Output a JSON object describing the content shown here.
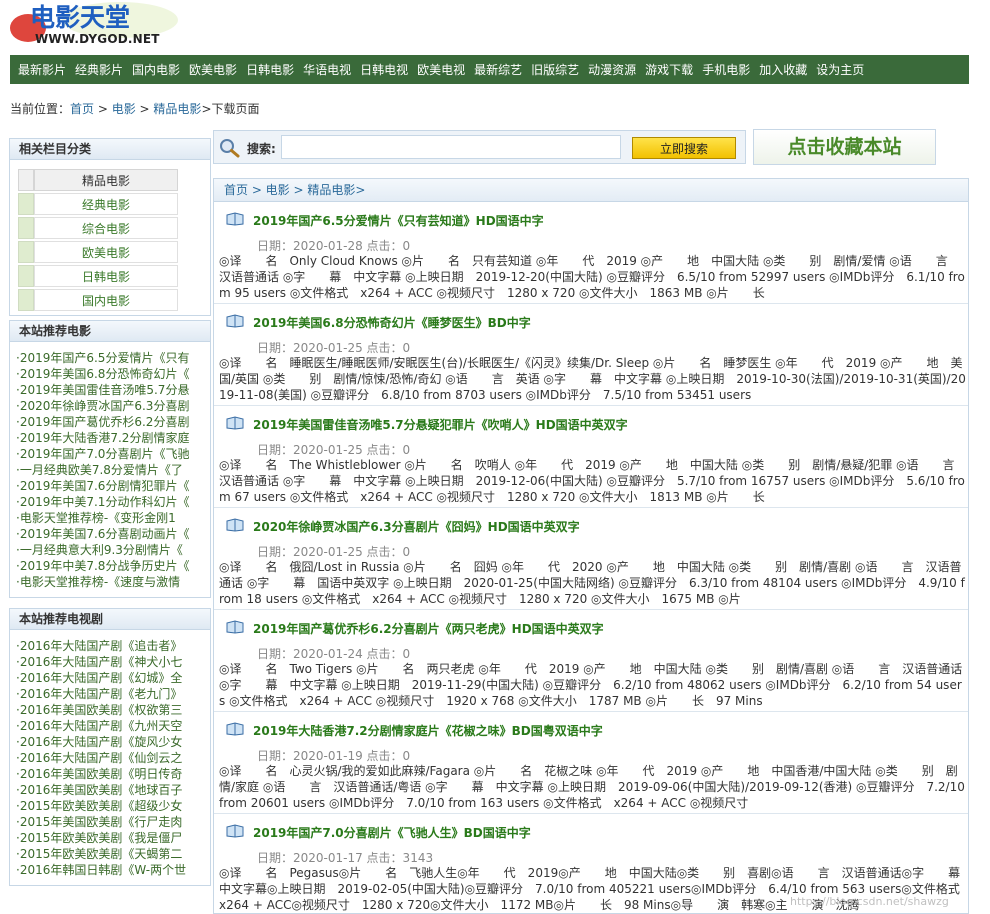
{
  "header": {
    "logo_text": "电影天堂",
    "logo_url": "WWW.DYGOD.NET",
    "nav": [
      "最新影片",
      "经典影片",
      "国内电影",
      "欧美电影",
      "日韩电影",
      "华语电视",
      "日韩电视",
      "欧美电视",
      "最新综艺",
      "旧版综艺",
      "动漫资源",
      "游戏下载",
      "手机电影",
      "加入收藏",
      "设为主页"
    ]
  },
  "breadcrumb": {
    "prefix": "当前位置：",
    "items": [
      "首页",
      "电影",
      "精品电影"
    ],
    "sep": " > ",
    "current": "下载页面"
  },
  "sidebar": {
    "category_title": "相关栏目分类",
    "categories": [
      "精品电影",
      "经典电影",
      "综合电影",
      "欧美电影",
      "日韩电影",
      "国内电影"
    ],
    "rec_movie_title": "本站推荐电影",
    "rec_movies": [
      "·2019年国产6.5分爱情片《只有",
      "·2019年美国6.8分恐怖奇幻片《",
      "·2019年美国雷佳音汤唯5.7分悬",
      "·2020年徐峥贾冰国产6.3分喜剧",
      "·2019年国产葛优乔杉6.2分喜剧",
      "·2019年大陆香港7.2分剧情家庭",
      "·2019年国产7.0分喜剧片《飞驰",
      "·一月经典欧美7.8分爱情片《了",
      "·2019年美国7.6分剧情犯罪片《",
      "·2019年中美7.1分动作科幻片《",
      "·电影天堂推荐榜-《变形金刚1",
      "·2019年美国7.6分喜剧动画片《",
      "·一月经典意大利9.3分剧情片《",
      "·2019年中美7.8分战争历史片《",
      "·电影天堂推荐榜-《速度与激情"
    ],
    "rec_tv_title": "本站推荐电视剧",
    "rec_tv": [
      "·2016年大陆国产剧《追击者》",
      "·2016年大陆国产剧《神犬小七",
      "·2016年大陆国产剧《幻城》全",
      "·2016年大陆国产剧《老九门》",
      "·2016年美国欧美剧《权欲第三",
      "·2016年大陆国产剧《九州天空",
      "·2016年大陆国产剧《旋风少女",
      "·2016年大陆国产剧《仙剑云之",
      "·2016年美国欧美剧《明日传奇",
      "·2016年美国欧美剧《地球百子",
      "·2015年欧美欧美剧《超级少女",
      "·2015年美国欧美剧《行尸走肉",
      "·2015年欧美欧美剧《我是僵尸",
      "·2015年欧美欧美剧《天蝎第二",
      "·2016年韩国日韩剧《W-两个世"
    ]
  },
  "search": {
    "label": "搜索:",
    "placeholder": "",
    "button": "立即搜索",
    "favorite": "点击收藏本站"
  },
  "main": {
    "crumb": "首页 > 电影 > 精品电影>",
    "entries": [
      {
        "title": "2019年国产6.5分爱情片《只有芸知道》HD国语中字",
        "date": "日期：2020-01-28 点击：0",
        "desc": "◎译　　名　Only Cloud Knows ◎片　　名　只有芸知道 ◎年　　代　2019 ◎产　　地　中国大陆 ◎类　　别　剧情/爱情 ◎语　　言　汉语普通话 ◎字　　幕　中文字幕 ◎上映日期　2019-12-20(中国大陆) ◎豆瓣评分　6.5/10 from 52997 users ◎IMDb评分　6.1/10 from 95 users ◎文件格式　x264 + ACC ◎视频尺寸　1280 x 720 ◎文件大小　1863 MB ◎片　　长"
      },
      {
        "title": "2019年美国6.8分恐怖奇幻片《睡梦医生》BD中字",
        "date": "日期：2020-01-25 点击：0",
        "desc": "◎译　　名　睡眠医生/睡眠医师/安眠医生(台)/长眠医生/《闪灵》续集/Dr. Sleep ◎片　　名　睡梦医生 ◎年　　代　2019 ◎产　　地　美国/英国 ◎类　　别　剧情/惊悚/恐怖/奇幻 ◎语　　言　英语 ◎字　　幕　中文字幕 ◎上映日期　2019-10-30(法国)/2019-10-31(英国)/2019-11-08(美国) ◎豆瓣评分　6.8/10 from 8703 users ◎IMDb评分　7.5/10 from 53451 users"
      },
      {
        "title": "2019年美国雷佳音汤唯5.7分悬疑犯罪片《吹哨人》HD国语中英双字",
        "date": "日期：2020-01-25 点击：0",
        "desc": "◎译　　名　The Whistleblower ◎片　　名　吹哨人 ◎年　　代　2019 ◎产　　地　中国大陆 ◎类　　别　剧情/悬疑/犯罪 ◎语　　言　汉语普通话 ◎字　　幕　中文字幕 ◎上映日期　2019-12-06(中国大陆) ◎豆瓣评分　5.7/10 from 16757 users ◎IMDb评分　5.6/10 from 67 users ◎文件格式　x264 + ACC ◎视频尺寸　1280 x 720 ◎文件大小　1813 MB ◎片　　长"
      },
      {
        "title": "2020年徐峥贾冰国产6.3分喜剧片《囧妈》HD国语中英双字",
        "date": "日期：2020-01-25 点击：0",
        "desc": "◎译　　名　俄囧/Lost in Russia ◎片　　名　囧妈 ◎年　　代　2020 ◎产　　地　中国大陆 ◎类　　别　剧情/喜剧 ◎语　　言　汉语普通话 ◎字　　幕　国语中英双字 ◎上映日期　2020-01-25(中国大陆网络) ◎豆瓣评分　6.3/10 from 48104 users ◎IMDb评分　4.9/10 from 18 users ◎文件格式　x264 + ACC ◎视频尺寸　1280 x 720 ◎文件大小　1675 MB ◎片"
      },
      {
        "title": "2019年国产葛优乔杉6.2分喜剧片《两只老虎》HD国语中英双字",
        "date": "日期：2020-01-24 点击：0",
        "desc": "◎译　　名　Two Tigers ◎片　　名　两只老虎 ◎年　　代　2019 ◎产　　地　中国大陆 ◎类　　别　剧情/喜剧 ◎语　　言　汉语普通话 ◎字　　幕　中文字幕 ◎上映日期　2019-11-29(中国大陆) ◎豆瓣评分　6.2/10 from 48062 users ◎IMDb评分　6.2/10 from 54 users ◎文件格式　x264 + ACC ◎视频尺寸　1920 x 768 ◎文件大小　1787 MB ◎片　　长　97 Mins"
      },
      {
        "title": "2019年大陆香港7.2分剧情家庭片《花椒之味》BD国粤双语中字",
        "date": "日期：2020-01-19 点击：0",
        "desc": "◎译　　名　心灵火锅/我的爱如此麻辣/Fagara ◎片　　名　花椒之味 ◎年　　代　2019 ◎产　　地　中国香港/中国大陆 ◎类　　别　剧情/家庭 ◎语　　言　汉语普通话/粤语 ◎字　　幕　中文字幕 ◎上映日期　2019-09-06(中国大陆)/2019-09-12(香港) ◎豆瓣评分　7.2/10 from 20601 users ◎IMDb评分　7.0/10 from 163 users ◎文件格式　x264 + ACC ◎视频尺寸"
      },
      {
        "title": "2019年国产7.0分喜剧片《飞驰人生》BD国语中字",
        "date": "日期：2020-01-17 点击：3143",
        "desc": "◎译　　名　Pegasus◎片　　名　飞驰人生◎年　　代　2019◎产　　地　中国大陆◎类　　别　喜剧◎语　　言　汉语普通话◎字　　幕　中文字幕◎上映日期　2019-02-05(中国大陆)◎豆瓣评分　7.0/10 from 405221 users◎IMDb评分　6.4/10 from 563 users◎文件格式　x264 + ACC◎视频尺寸　1280 x 720◎文件大小　1172 MB◎片　　长　98 Mins◎导　　演　韩寒◎主　　演　沈腾"
      }
    ]
  },
  "watermark": "https://blog.csdn.net/shawzg",
  "colors": {
    "nav_bg": "#3a6a3a",
    "title_green": "#2a7a1a",
    "link_blue": "#2b6a9a",
    "button_yellow": "#f2c100"
  }
}
